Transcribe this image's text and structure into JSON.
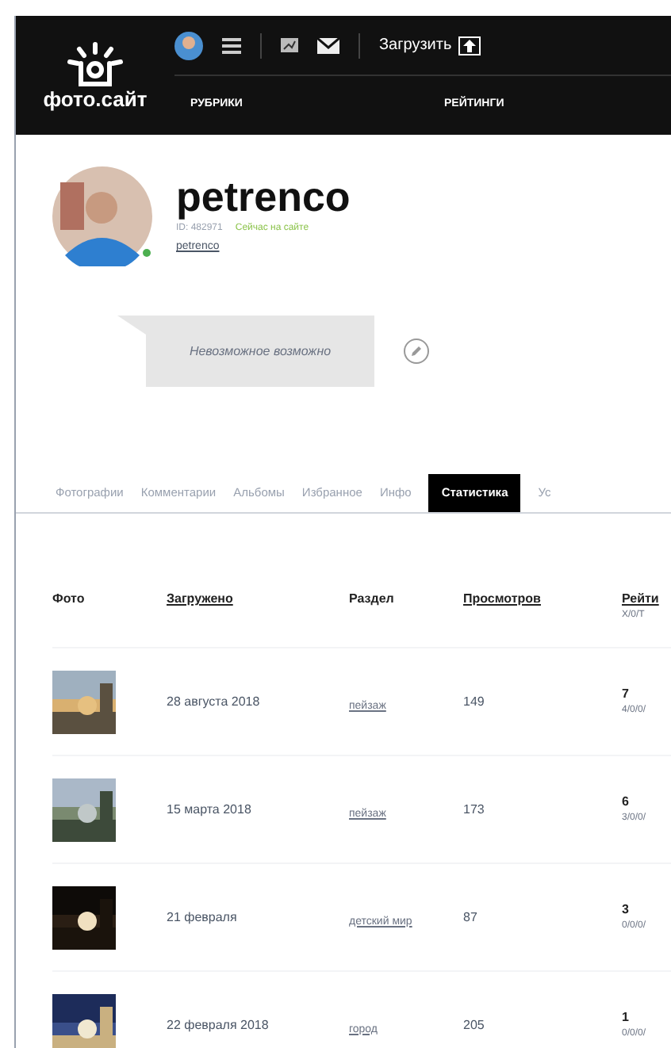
{
  "header": {
    "logo": "фото.сайт",
    "upload": "Загрузить",
    "nav": [
      "РУБРИКИ",
      "РЕЙТИНГИ"
    ]
  },
  "profile": {
    "name": "petrenco",
    "id": "ID: 482971",
    "online": true,
    "status": "Сейчас на сайте",
    "login": "petrenco",
    "motto": "Невозможное возможно"
  },
  "tabs": [
    {
      "label": "Фотографии",
      "selected": false
    },
    {
      "label": "Комментарии",
      "selected": false
    },
    {
      "label": "Альбомы",
      "selected": false
    },
    {
      "label": "Избранное",
      "selected": false
    },
    {
      "label": "Инфо",
      "selected": false
    },
    {
      "label": "Статистика",
      "selected": true
    },
    {
      "label": "Ус",
      "selected": false
    }
  ],
  "table": {
    "columns": [
      {
        "label": "Фото",
        "sortable": false
      },
      {
        "label": "Загружено",
        "sortable": true
      },
      {
        "label": "Раздел",
        "sortable": false
      },
      {
        "label": "Просмотров",
        "sortable": true
      },
      {
        "label": "Рейти",
        "sortable": true,
        "sub": "X/0/T"
      }
    ],
    "rows": [
      {
        "uploaded": "28 августа 2018",
        "section": "пейзаж",
        "views": "149",
        "rating": "7",
        "detail": "4/0/0/"
      },
      {
        "uploaded": "15 марта 2018",
        "section": "пейзаж",
        "views": "173",
        "rating": "6",
        "detail": "3/0/0/"
      },
      {
        "uploaded": "21 февраля",
        "section": "детский мир",
        "views": "87",
        "rating": "3",
        "detail": "0/0/0/"
      },
      {
        "uploaded": "22 февраля 2018",
        "section": "город",
        "views": "205",
        "rating": "1",
        "detail": "0/0/0/"
      }
    ]
  }
}
